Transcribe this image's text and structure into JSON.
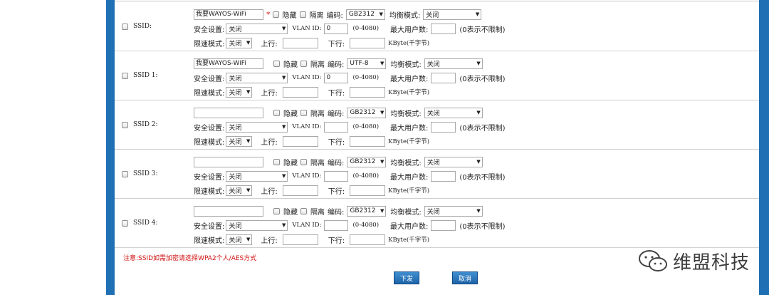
{
  "rows": [
    {
      "label": "SSID:",
      "ssid_value": "我要WAYOS-WiFi",
      "required_mark": "*",
      "hidden_label": "隐藏",
      "isolate_label": "隔离",
      "encoding_label": "编码:",
      "encoding": "GB2312",
      "balance_label": "均衡模式:",
      "balance": "关闭",
      "security_label": "安全设置:",
      "security": "关闭",
      "vlan_label": "VLAN ID:",
      "vlan_value": "0",
      "vlan_range": "(0-4080)",
      "maxusers_label": "最大用户数:",
      "maxusers_value": "",
      "maxusers_hint": "(0表示不限制)",
      "limit_label": "限速模式:",
      "limit": "关闭",
      "up_label": "上行:",
      "up_value": "",
      "down_label": "下行:",
      "down_value": "",
      "unit": "KByte(千字节)"
    },
    {
      "label": "SSID 1:",
      "ssid_value": "我要WAYOS-WiFi",
      "required_mark": "",
      "hidden_label": "隐藏",
      "isolate_label": "隔离",
      "encoding_label": "编码:",
      "encoding": "UTF-8",
      "balance_label": "均衡模式:",
      "balance": "关闭",
      "security_label": "安全设置:",
      "security": "关闭",
      "vlan_label": "VLAN ID:",
      "vlan_value": "0",
      "vlan_range": "(0-4080)",
      "maxusers_label": "最大用户数:",
      "maxusers_value": "",
      "maxusers_hint": "(0表示不限制)",
      "limit_label": "限速模式:",
      "limit": "关闭",
      "up_label": "上行:",
      "up_value": "",
      "down_label": "下行:",
      "down_value": "",
      "unit": "KByte(千字节)"
    },
    {
      "label": "SSID 2:",
      "ssid_value": "",
      "required_mark": "",
      "hidden_label": "隐藏",
      "isolate_label": "隔离",
      "encoding_label": "编码:",
      "encoding": "GB2312",
      "balance_label": "均衡模式:",
      "balance": "关闭",
      "security_label": "安全设置:",
      "security": "关闭",
      "vlan_label": "VLAN ID:",
      "vlan_value": "",
      "vlan_range": "(0-4080)",
      "maxusers_label": "最大用户数:",
      "maxusers_value": "",
      "maxusers_hint": "(0表示不限制)",
      "limit_label": "限速模式:",
      "limit": "关闭",
      "up_label": "上行:",
      "up_value": "",
      "down_label": "下行:",
      "down_value": "",
      "unit": "KByte(千字节)"
    },
    {
      "label": "SSID 3:",
      "ssid_value": "",
      "required_mark": "",
      "hidden_label": "隐藏",
      "isolate_label": "隔离",
      "encoding_label": "编码:",
      "encoding": "GB2312",
      "balance_label": "均衡模式:",
      "balance": "关闭",
      "security_label": "安全设置:",
      "security": "关闭",
      "vlan_label": "VLAN ID:",
      "vlan_value": "",
      "vlan_range": "(0-4080)",
      "maxusers_label": "最大用户数:",
      "maxusers_value": "",
      "maxusers_hint": "(0表示不限制)",
      "limit_label": "限速模式:",
      "limit": "关闭",
      "up_label": "上行:",
      "up_value": "",
      "down_label": "下行:",
      "down_value": "",
      "unit": "KByte(千字节)"
    },
    {
      "label": "SSID 4:",
      "ssid_value": "",
      "required_mark": "",
      "hidden_label": "隐藏",
      "isolate_label": "隔离",
      "encoding_label": "编码:",
      "encoding": "GB2312",
      "balance_label": "均衡模式:",
      "balance": "关闭",
      "security_label": "安全设置:",
      "security": "关闭",
      "vlan_label": "VLAN ID:",
      "vlan_value": "",
      "vlan_range": "(0-4080)",
      "maxusers_label": "最大用户数:",
      "maxusers_value": "",
      "maxusers_hint": "(0表示不限制)",
      "limit_label": "限速模式:",
      "limit": "关闭",
      "up_label": "上行:",
      "up_value": "",
      "down_label": "下行:",
      "down_value": "",
      "unit": "KByte(千字节)"
    }
  ],
  "note": "注意:SSID如需加密请选择WPA2个人/AES方式",
  "buttons": {
    "submit": "下发",
    "cancel": "取消"
  },
  "watermark": {
    "text": "维盟科技",
    "icon": "wechat-icon"
  },
  "colors": {
    "frame": "#1f6fb5",
    "button": "#2a78c0",
    "note": "#d01010"
  }
}
